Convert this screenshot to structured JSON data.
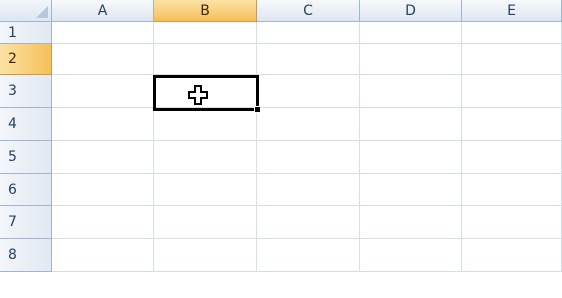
{
  "columns": [
    {
      "label": "A",
      "selected": false
    },
    {
      "label": "B",
      "selected": true
    },
    {
      "label": "C",
      "selected": false
    },
    {
      "label": "D",
      "selected": false
    },
    {
      "label": "E",
      "selected": false
    }
  ],
  "rows": [
    {
      "label": "1",
      "selected": false
    },
    {
      "label": "2",
      "selected": true
    },
    {
      "label": "3",
      "selected": false
    },
    {
      "label": "4",
      "selected": false
    },
    {
      "label": "5",
      "selected": false
    },
    {
      "label": "6",
      "selected": false
    },
    {
      "label": "7",
      "selected": false
    },
    {
      "label": "8",
      "selected": false
    }
  ],
  "active_cell": {
    "column": "B",
    "row": "2"
  },
  "cursor": {
    "icon": "plus-cross-cursor-icon"
  },
  "colors": {
    "header_selected": "#f6bf5b",
    "header_border": "#9eb6ce",
    "gridline": "#d4dde8",
    "active_border": "#000000"
  }
}
